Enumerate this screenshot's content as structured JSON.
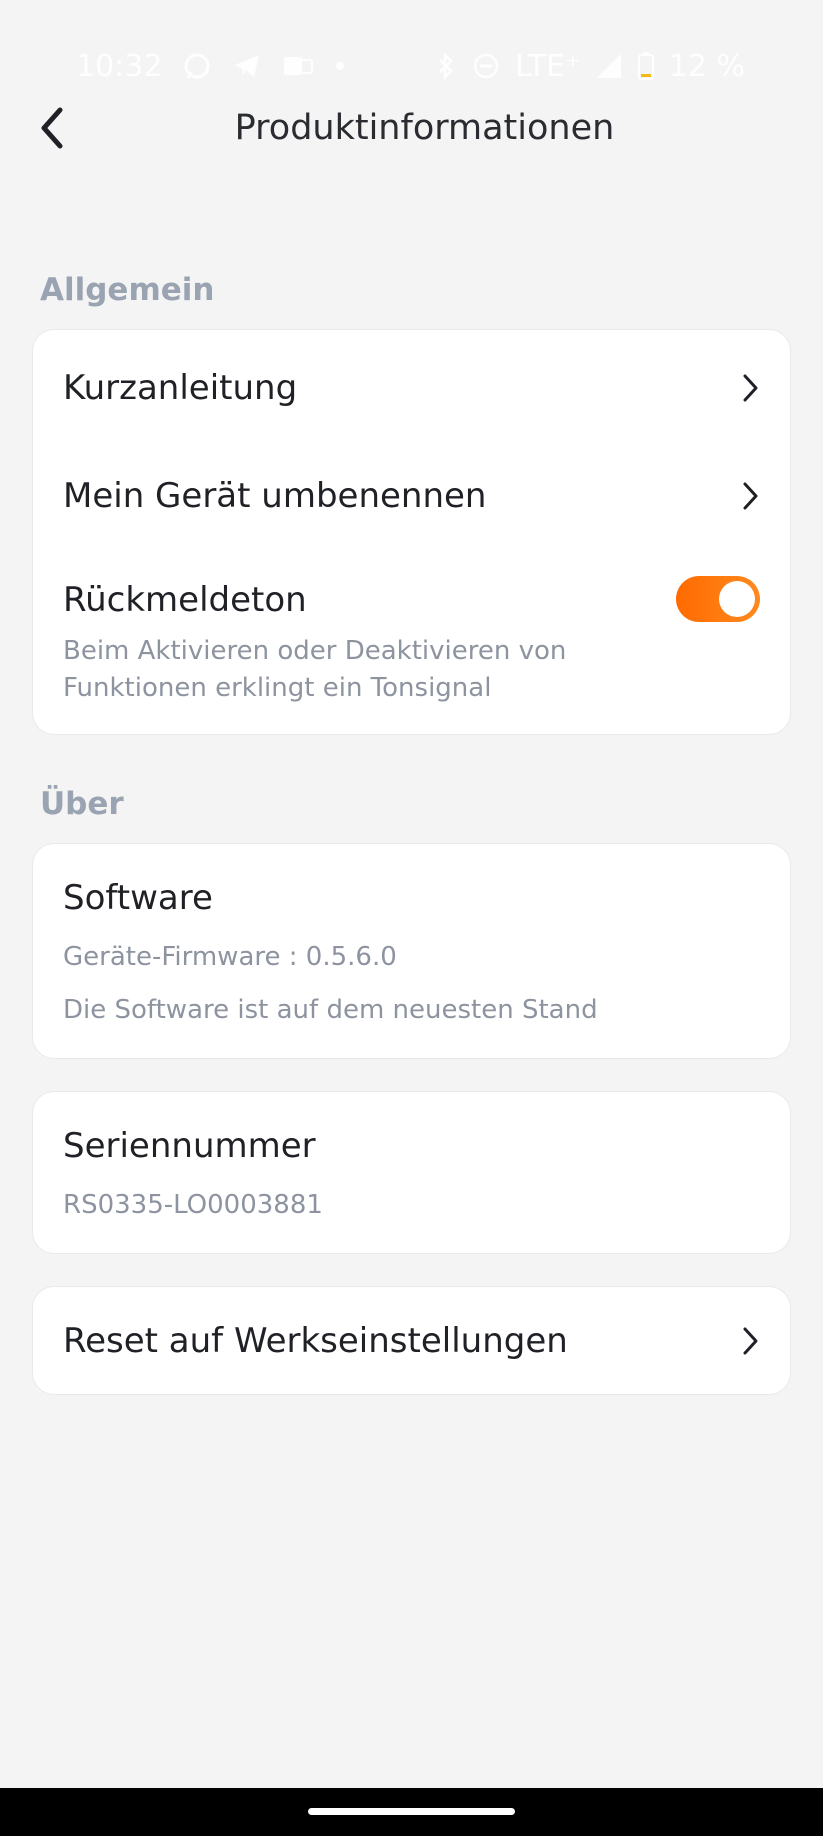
{
  "status_bar": {
    "time": "10:32",
    "network": "LTE⁺",
    "battery": "12 %",
    "icons_left": [
      "whatsapp-icon",
      "telegram-icon",
      "outlook-icon",
      "dot-icon"
    ],
    "icons_right": [
      "bluetooth-icon",
      "dnd-icon",
      "signal-icon",
      "battery-icon"
    ]
  },
  "header": {
    "title": "Produktinformationen",
    "back_icon": "chevron-left-icon"
  },
  "sections": {
    "general": {
      "title": "Allgemein",
      "items": [
        {
          "label": "Kurzanleitung"
        },
        {
          "label": "Mein Gerät umbenennen"
        }
      ],
      "feedback_tone": {
        "label": "Rückmeldeton",
        "description": "Beim Aktivieren oder Deaktivieren von Funktionen erklingt ein Tonsignal",
        "enabled": true
      }
    },
    "about": {
      "title": "Über",
      "software": {
        "title": "Software",
        "firmware": "Geräte-Firmware : 0.5.6.0",
        "status": "Die Software ist auf dem neuesten Stand"
      },
      "serial": {
        "title": "Seriennummer",
        "value": "RS0335-LO0003881"
      },
      "reset": {
        "label": "Reset auf Werkseinstellungen"
      }
    }
  },
  "colors": {
    "accent": "#ff7a0f",
    "background": "#f4f4f4",
    "section_title": "#9aa3b1",
    "secondary_text": "#8d94a0"
  }
}
